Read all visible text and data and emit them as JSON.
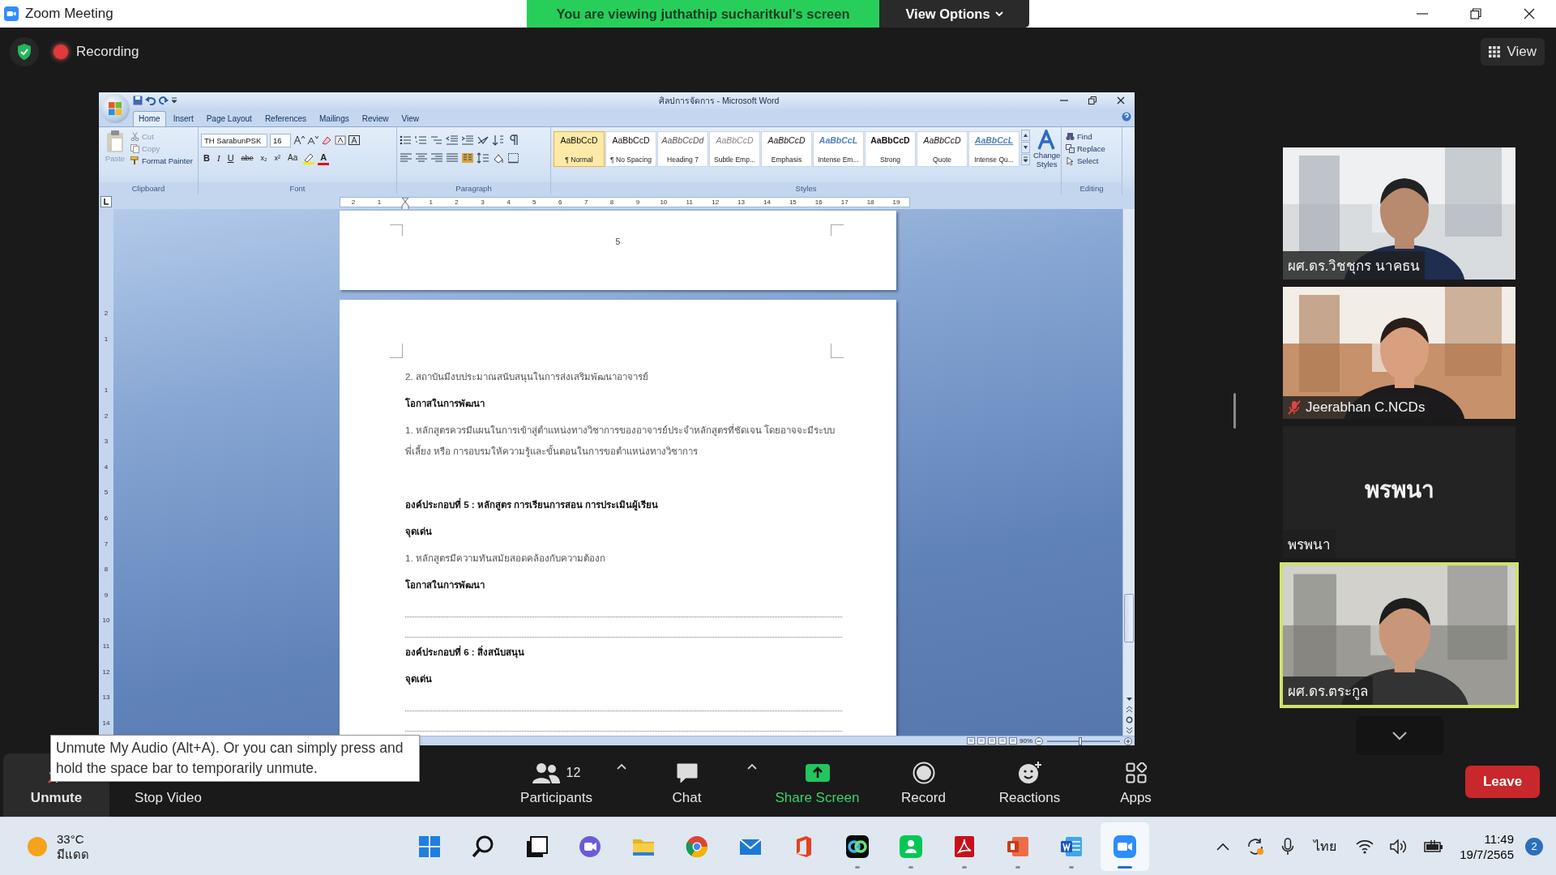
{
  "zoom_window": {
    "title": "Zoom Meeting",
    "banner": "You are viewing juthathip sucharitkul's screen",
    "view_options": "View Options"
  },
  "meeting_header": {
    "recording": "Recording",
    "view": "View"
  },
  "word": {
    "title": "ศิลปการจัดการ - Microsoft Word",
    "tabs": [
      {
        "label": "Home",
        "selected": true
      },
      {
        "label": "Insert",
        "selected": false
      },
      {
        "label": "Page Layout",
        "selected": false
      },
      {
        "label": "References",
        "selected": false
      },
      {
        "label": "Mailings",
        "selected": false
      },
      {
        "label": "Review",
        "selected": false
      },
      {
        "label": "View",
        "selected": false
      }
    ],
    "clipboard": {
      "paste": {
        "label": "Paste",
        "disabled": true
      },
      "items": [
        {
          "label": "Cut",
          "disabled": true
        },
        {
          "label": "Copy",
          "disabled": true
        },
        {
          "label": "Format Painter",
          "disabled": false
        }
      ]
    },
    "font": {
      "name": "TH SarabunPSK",
      "size": "16",
      "buttons": [
        {
          "kind": "bold",
          "label": "B"
        },
        {
          "kind": "italic",
          "label": "I"
        },
        {
          "kind": "underline",
          "label": "U"
        },
        {
          "kind": "strike",
          "label": "abe"
        },
        {
          "kind": "sub",
          "label": "x₂"
        },
        {
          "kind": "sup",
          "label": "x²"
        },
        {
          "kind": "case",
          "label": "Aa"
        },
        {
          "kind": "color",
          "label": "A"
        }
      ]
    },
    "styles": [
      {
        "sample": "AaBbCcD",
        "name": "¶ Normal",
        "selected": true
      },
      {
        "sample": "AaBbCcD",
        "name": "¶ No Spacing",
        "selected": false
      },
      {
        "sample": "AaBbCcDd",
        "name": "Heading 7",
        "selected": false
      },
      {
        "sample": "AaBbCcD",
        "name": "Subtle Emp...",
        "selected": false
      },
      {
        "sample": "AaBbCcD",
        "name": "Emphasis",
        "selected": false
      },
      {
        "sample": "AaBbCcL",
        "name": "Intense Em...",
        "selected": false
      },
      {
        "sample": "AaBbCcD",
        "name": "Strong",
        "selected": false
      },
      {
        "sample": "AaBbCcD",
        "name": "Quote",
        "selected": false
      },
      {
        "sample": "AaBbCcL",
        "name": "Intense Qu...",
        "selected": false
      }
    ],
    "change_styles": "Change Styles",
    "editing": [
      "Find",
      "Replace",
      "Select"
    ],
    "groups": [
      "Clipboard",
      "Font",
      "Paragraph",
      "Styles",
      "Editing"
    ],
    "ruler": [
      "2",
      "1",
      "1",
      "2",
      "3",
      "4",
      "5",
      "6",
      "7",
      "8",
      "9",
      "10",
      "11",
      "12",
      "13",
      "14",
      "15",
      "16",
      "17",
      "18",
      "19"
    ],
    "vertical_ruler": [
      "2",
      "1",
      "1",
      "2",
      "3",
      "4",
      "5",
      "6",
      "7",
      "8",
      "9",
      "10",
      "11",
      "12",
      "13",
      "14"
    ],
    "page_number": "5",
    "paragraphs": [
      {
        "kind": "text",
        "text": "2.  สถาบันมีงบประมาณสนับสนุนในการส่งเสริมพัฒนาอาจารย์"
      },
      {
        "kind": "heading",
        "text": "โอกาสในการพัฒนา"
      },
      {
        "kind": "text",
        "text": "1. หลักสูตรควรมีแผนในการเข้าสู่ตำแหน่งทางวิชาการของอาจารย์ประจำหลักสูตรที่ชัดเจน โดยอาจจะมีระบบพี่เลี้ยง หรือ การอบรมให้ความรู้และขั้นตอนในการขอตำแหน่งทางวิชาการ"
      },
      {
        "kind": "blank"
      },
      {
        "kind": "heading",
        "text": "องค์ประกอบที่ 5 : หลักสูตร การเรียนการสอน การประเมินผู้เรียน"
      },
      {
        "kind": "heading",
        "text": "จุดเด่น"
      },
      {
        "kind": "text",
        "text": "1.  หลักสูตรมีความทันสมัยสอดคล้องกับความต้องก"
      },
      {
        "kind": "heading",
        "text": "โอกาสในการพัฒนา"
      },
      {
        "kind": "dotted"
      },
      {
        "kind": "dotted"
      },
      {
        "kind": "heading",
        "text": "องค์ประกอบที่ 6 : สิ่งสนับสนุน"
      },
      {
        "kind": "heading",
        "text": "จุดเด่น"
      },
      {
        "kind": "dotted"
      },
      {
        "kind": "dotted"
      }
    ],
    "zoom": "90%",
    "zoom_slider": {
      "level": 0.45
    }
  },
  "participants": [
    {
      "kind": "video",
      "name": "ผศ.ดร.วิชชุกร นาคธน",
      "muted": false,
      "speaking": false
    },
    {
      "kind": "video",
      "name": "Jeerabhan C.NCDs",
      "muted": true,
      "speaking": false
    },
    {
      "kind": "name",
      "display": "พรพนา",
      "name": "พรพนา",
      "muted": false,
      "speaking": false
    },
    {
      "kind": "video",
      "name": "ผศ.ดร.ตระกูล",
      "muted": false,
      "speaking": true
    }
  ],
  "tooltip": "Unmute My Audio (Alt+A). Or you can simply press and hold the space bar to temporarily unmute.",
  "toolbar": {
    "buttons": [
      {
        "kind": "mic",
        "label": "Unmute",
        "muted": true
      },
      {
        "kind": "camera",
        "label": "Stop Video"
      },
      {
        "kind": "participants",
        "label": "Participants",
        "count": "12",
        "caret": true
      },
      {
        "kind": "chat",
        "label": "Chat",
        "caret": true
      },
      {
        "kind": "share",
        "label": "Share Screen"
      },
      {
        "kind": "record",
        "label": "Record"
      },
      {
        "kind": "reactions",
        "label": "Reactions"
      },
      {
        "kind": "apps",
        "label": "Apps"
      }
    ],
    "leave": "Leave"
  },
  "taskbar": {
    "weather": {
      "temperature": "33°C",
      "condition": "มีแดด"
    },
    "apps": [
      {
        "running": false,
        "active": false
      },
      {
        "running": false,
        "active": false
      },
      {
        "running": false,
        "active": false
      },
      {
        "running": false,
        "active": false
      },
      {
        "running": false,
        "active": false
      },
      {
        "running": false,
        "active": false
      },
      {
        "running": false,
        "active": false
      },
      {
        "running": false,
        "active": false
      },
      {
        "running": true,
        "active": false
      },
      {
        "running": true,
        "active": false
      },
      {
        "running": true,
        "active": false
      },
      {
        "running": true,
        "active": false
      },
      {
        "running": true,
        "active": false
      },
      {
        "running": true,
        "active": true
      }
    ],
    "language": "ไทย",
    "time": "11:49",
    "date": "19/7/2565",
    "notifications": "2"
  }
}
